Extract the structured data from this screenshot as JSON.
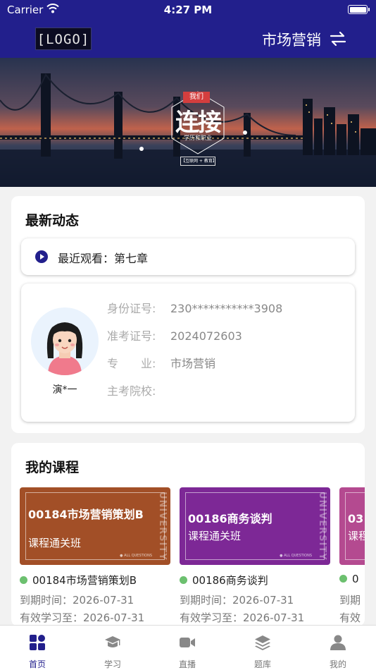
{
  "status_bar": {
    "carrier": "Carrier",
    "time": "4:27 PM"
  },
  "header": {
    "logo": "[LOGO]",
    "title": "市场营销",
    "switch_icon": "swap-arrows-icon"
  },
  "banner": {
    "tag": "我们",
    "headline": "连接",
    "subtitle": "学历和职业",
    "footer": "【互联网 + 教育】"
  },
  "news": {
    "title": "最新动态",
    "recent_label": "最近观看：第七章",
    "profile": {
      "name": "演*一",
      "fields": [
        {
          "label": "身份证号:",
          "value": "230***********3908"
        },
        {
          "label": "准考证号:",
          "value": "2024072603"
        },
        {
          "label": "专　　业:",
          "value": "市场营销"
        },
        {
          "label": "主考院校:",
          "value": ""
        }
      ]
    }
  },
  "my_courses": {
    "title": "我的课程",
    "items": [
      {
        "cover_title": "00184市场营销策划B",
        "cover_sub": "课程通关班",
        "cover_color": "#a24f27",
        "name": "00184市场营销策划B",
        "expire_label": "到期时间：",
        "expire": "2026-07-31",
        "valid_label": "有效学习至：",
        "valid": "2026-07-31"
      },
      {
        "cover_title": "00186商务谈判",
        "cover_sub": "课程通关班",
        "cover_color": "#7d2896",
        "name": "00186商务谈判",
        "expire_label": "到期时间：",
        "expire": "2026-07-31",
        "valid_label": "有效学习至：",
        "valid": "2026-07-31"
      },
      {
        "cover_title": "03",
        "cover_sub": "课程",
        "cover_color": "#b44a90",
        "name": "0",
        "expire_label": "到期",
        "expire": "",
        "valid_label": "有效",
        "valid": ""
      }
    ],
    "cover_vertical": "UNIVERSITY",
    "cover_tag": "● ALL QUESTIONS"
  },
  "tabbar": {
    "items": [
      {
        "label": "首页",
        "icon": "home-icon"
      },
      {
        "label": "学习",
        "icon": "graduation-cap-icon"
      },
      {
        "label": "直播",
        "icon": "video-camera-icon"
      },
      {
        "label": "题库",
        "icon": "layers-icon"
      },
      {
        "label": "我的",
        "icon": "user-icon"
      }
    ],
    "active_index": 0
  },
  "colors": {
    "primary": "#221f8c",
    "status_dot": "#6cc06f"
  }
}
